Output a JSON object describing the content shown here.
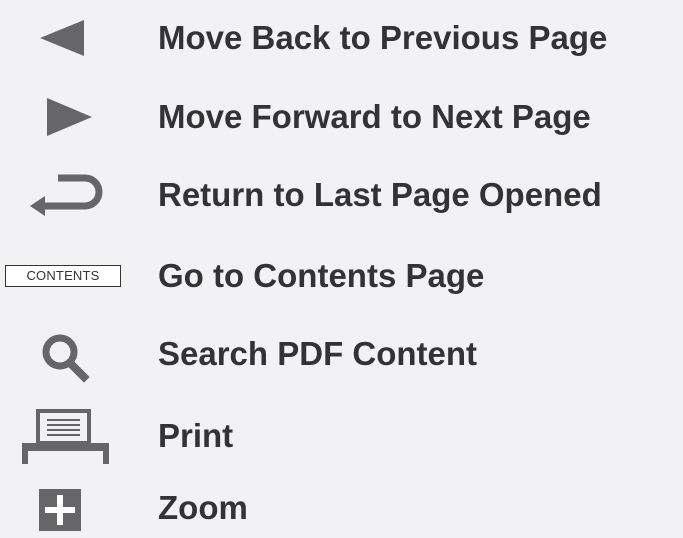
{
  "legend": {
    "items": [
      {
        "icon": "back-arrow-icon",
        "label": "Move Back to Previous Page"
      },
      {
        "icon": "forward-arrow-icon",
        "label": "Move Forward to Next Page"
      },
      {
        "icon": "return-arrow-icon",
        "label": "Return to Last Page Opened"
      },
      {
        "icon": "contents-button-icon",
        "badge": "CONTENTS",
        "label": "Go to Contents Page"
      },
      {
        "icon": "search-icon",
        "label": "Search PDF Content"
      },
      {
        "icon": "print-icon",
        "label": "Print"
      },
      {
        "icon": "zoom-icon",
        "label": "Zoom"
      }
    ]
  },
  "colors": {
    "background": "#f2f2f4",
    "icon_gray": "#666668",
    "text": "#333335"
  }
}
